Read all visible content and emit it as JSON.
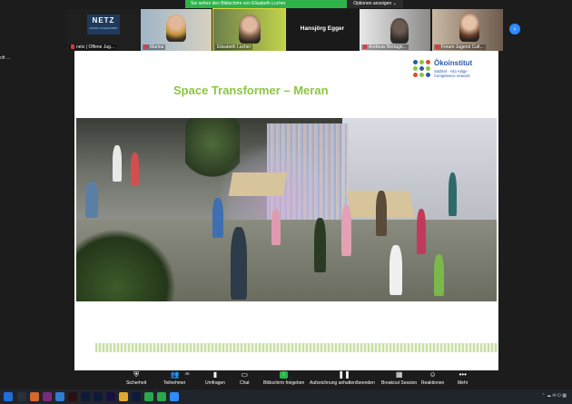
{
  "share_banner": {
    "text": "Sie sehen den Bildschirm von Elisabeth Locher",
    "options_label": "Optionen anzeigen ⌄"
  },
  "participants": [
    {
      "name": "netz | Offene Jug...",
      "logo_text": "NETZ",
      "logo_sub": "OFFENE JUGENDARBEIT"
    },
    {
      "name": "Marina"
    },
    {
      "name": "Elisabeth Locher"
    },
    {
      "name": "Hansjörg Egger",
      "center_label": "Hansjörg Egger"
    },
    {
      "name": "Andreas Bertagn..."
    },
    {
      "name": "Forum Jugend Cult..."
    }
  ],
  "left_tools_text": "oft ...",
  "slide": {
    "title": "Space Transformer – Meran",
    "logo": {
      "brand": "Ökoinstitut",
      "line1": "Südtirol · Alto Adige",
      "line2": "Competence network"
    }
  },
  "toolbar": [
    {
      "label": "Sicherheit",
      "icon": "shield-icon"
    },
    {
      "label": "Teilnehmer",
      "icon": "participants-icon",
      "badge": "46"
    },
    {
      "label": "Umfragen",
      "icon": "poll-icon"
    },
    {
      "label": "Chat",
      "icon": "chat-icon"
    },
    {
      "label": "Bildschirm freigeben",
      "icon": "share-screen-icon"
    },
    {
      "label": "Aufzeichnung anhalten/beenden",
      "icon": "record-icon"
    },
    {
      "label": "Breakout Session",
      "icon": "breakout-icon"
    },
    {
      "label": "Reaktionen",
      "icon": "reactions-icon"
    },
    {
      "label": "Mehr",
      "icon": "more-icon"
    }
  ],
  "colors": {
    "share_green": "#2db34a",
    "title_green": "#8cc63f",
    "brand_blue": "#2b5aa8",
    "zoom_blue": "#2d8cff"
  }
}
